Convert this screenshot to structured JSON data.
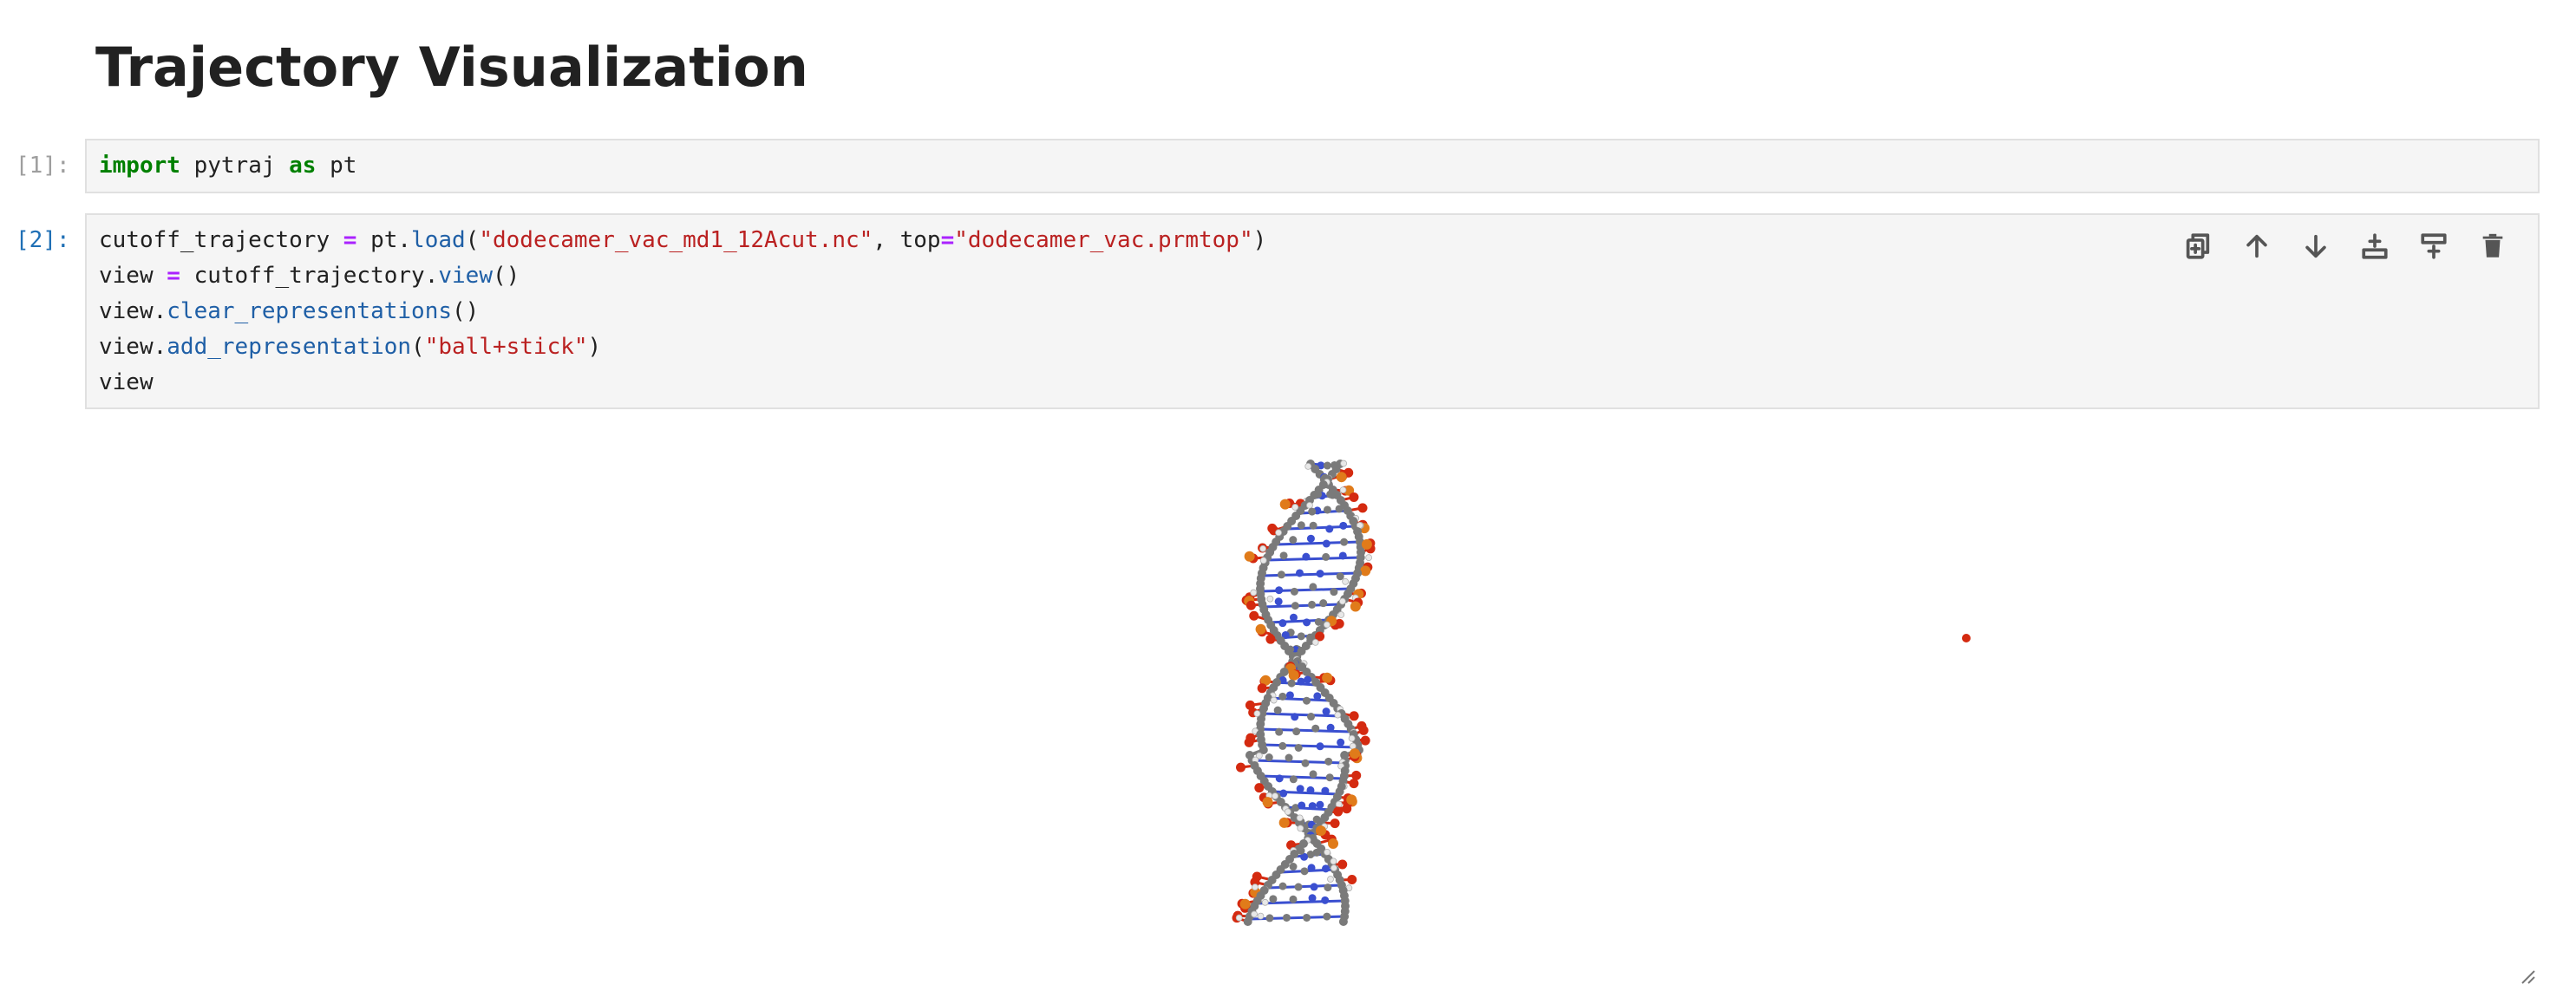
{
  "notebook": {
    "heading": "Trajectory Visualization",
    "cells": [
      {
        "prompt": "[1]:",
        "code": {
          "kw_import": "import",
          "mod": " pytraj ",
          "kw_as": "as",
          "alias": " pt"
        }
      },
      {
        "prompt": "[2]:",
        "lines": {
          "l1_a": "cutoff_trajectory ",
          "l1_eq": "=",
          "l1_b": " pt.",
          "l1_fn": "load",
          "l1_c": "(",
          "l1_s1": "\"dodecamer_vac_md1_12Acut.nc\"",
          "l1_d": ", top",
          "l1_eq2": "=",
          "l1_s2": "\"dodecamer_vac.prmtop\"",
          "l1_e": ")",
          "l2_a": "view ",
          "l2_eq": "=",
          "l2_b": " cutoff_trajectory.",
          "l2_fn": "view",
          "l2_c": "()",
          "l3_a": "view.",
          "l3_fn": "clear_representations",
          "l3_c": "()",
          "l4_a": "view.",
          "l4_fn": "add_representation",
          "l4_c": "(",
          "l4_s": "\"ball+stick\"",
          "l4_d": ")",
          "l5_a": "view"
        }
      }
    ]
  },
  "toolbar": {
    "icons": [
      "duplicate-icon",
      "move-up-icon",
      "move-down-icon",
      "insert-above-icon",
      "insert-below-icon",
      "delete-icon"
    ]
  },
  "colors": {
    "carbon": "#7a7a7a",
    "nitrogen": "#3a4fd0",
    "oxygen": "#d42a10",
    "phosphorus": "#e07b1a",
    "hydrogen": "#e8e8e8",
    "prompt_active": "#1f6fb5"
  }
}
